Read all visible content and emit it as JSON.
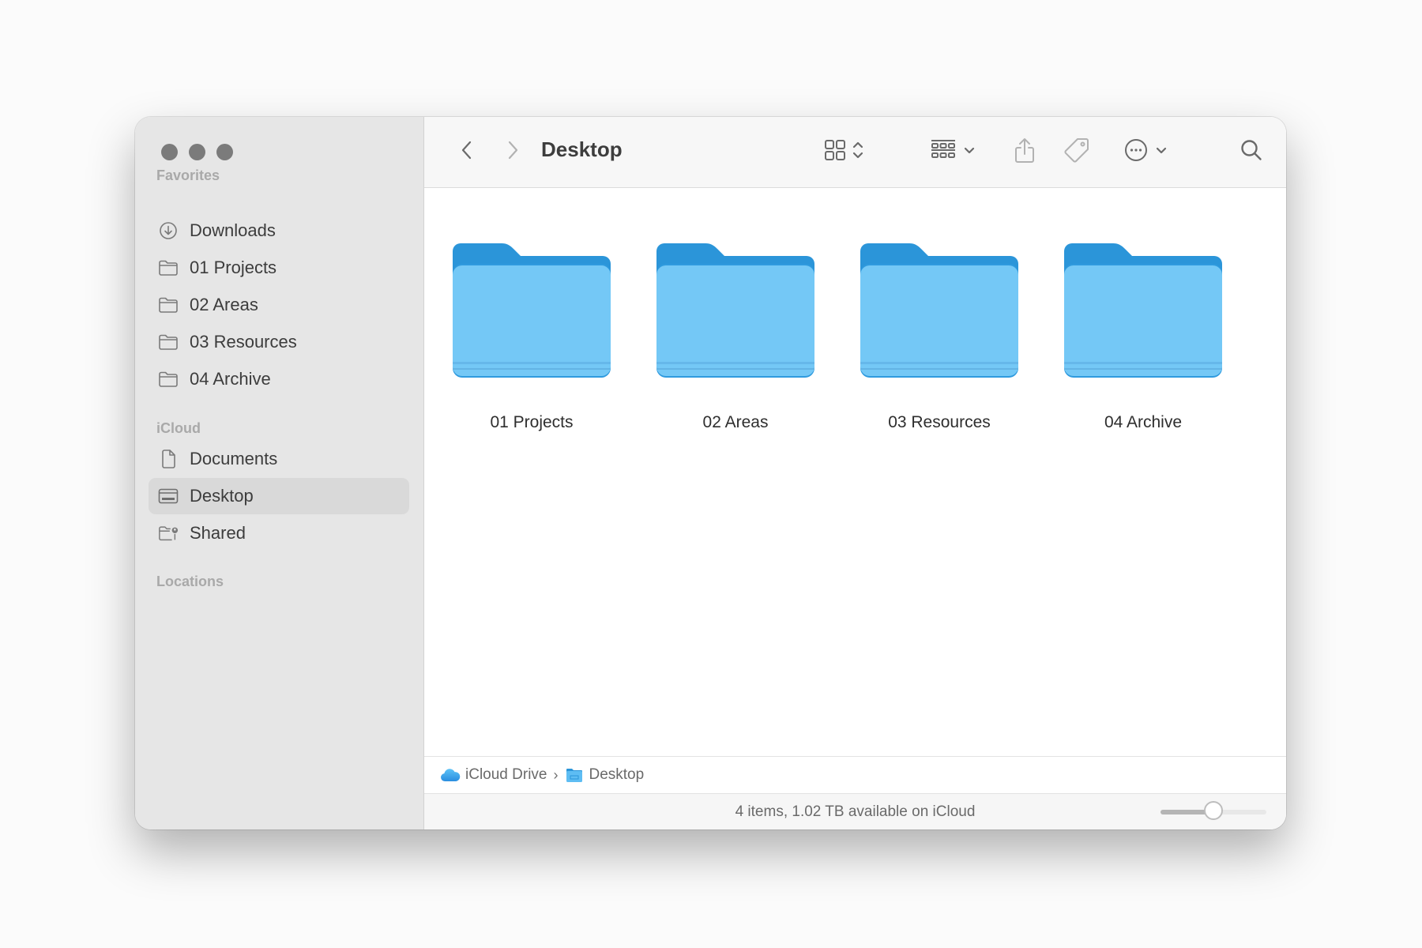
{
  "window": {
    "title": "Desktop",
    "traffic_lights": [
      "close",
      "minimize",
      "zoom"
    ]
  },
  "sidebar": {
    "sections": [
      {
        "header": "Favorites",
        "items": [
          {
            "label": "Downloads",
            "icon": "download-circle-icon",
            "selected": false
          },
          {
            "label": "01 Projects",
            "icon": "folder-icon",
            "selected": false
          },
          {
            "label": "02 Areas",
            "icon": "folder-icon",
            "selected": false
          },
          {
            "label": "03 Resources",
            "icon": "folder-icon",
            "selected": false
          },
          {
            "label": "04 Archive",
            "icon": "folder-icon",
            "selected": false
          }
        ]
      },
      {
        "header": "iCloud",
        "items": [
          {
            "label": "Documents",
            "icon": "document-icon",
            "selected": false
          },
          {
            "label": "Desktop",
            "icon": "desktop-icon",
            "selected": true
          },
          {
            "label": "Shared",
            "icon": "shared-folder-icon",
            "selected": false
          }
        ]
      },
      {
        "header": "Locations",
        "items": []
      }
    ]
  },
  "toolbar": {
    "back": "chevron-left-icon",
    "forward": "chevron-right-icon",
    "title": "Desktop",
    "view_mode": "icon-grid-icon",
    "group": "group-grid-icon",
    "share": "share-icon",
    "tag": "tag-icon",
    "more": "ellipsis-circle-icon",
    "search": "search-icon"
  },
  "files": [
    {
      "name": "01 Projects",
      "type": "folder"
    },
    {
      "name": "02 Areas",
      "type": "folder"
    },
    {
      "name": "03 Resources",
      "type": "folder"
    },
    {
      "name": "04 Archive",
      "type": "folder"
    }
  ],
  "pathbar": {
    "segments": [
      {
        "label": "iCloud Drive",
        "icon": "icloud-icon"
      },
      {
        "label": "Desktop",
        "icon": "desktop-folder-icon"
      }
    ],
    "separator": "›"
  },
  "status": {
    "text": "4 items, 1.02 TB available on iCloud",
    "icon_size_slider": 0.5
  },
  "colors": {
    "folder_front": "#74c8f6",
    "folder_back": "#2b95d9",
    "sidebar_bg": "#e6e6e6",
    "selection_bg": "#d9d9d9",
    "traffic_light": "#7b7b7b"
  }
}
